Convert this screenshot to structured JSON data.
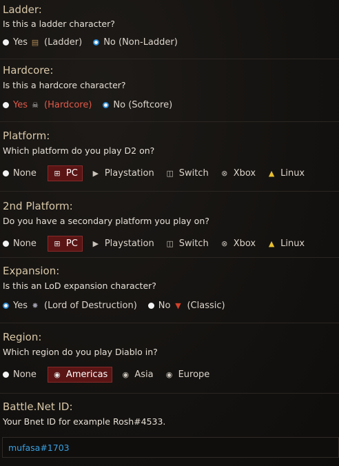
{
  "ladder": {
    "title": "Ladder:",
    "question": "Is this a ladder character?",
    "yes": "Yes",
    "yes_tag": "(Ladder)",
    "no": "No (Non-Ladder)",
    "selected": "no"
  },
  "hardcore": {
    "title": "Hardcore:",
    "question": "Is this a hardcore character?",
    "yes": "Yes",
    "yes_tag": "(Hardcore)",
    "no": "No (Softcore)",
    "selected": "no",
    "yes_color": "#e05a4a"
  },
  "platform": {
    "title": "Platform:",
    "question": "Which platform do you play D2 on?",
    "none": "None",
    "options": [
      "PC",
      "Playstation",
      "Switch",
      "Xbox",
      "Linux"
    ],
    "selected": "PC"
  },
  "platform2": {
    "title": "2nd Platform:",
    "question": "Do you have a secondary platform you play on?",
    "none": "None",
    "options": [
      "PC",
      "Playstation",
      "Switch",
      "Xbox",
      "Linux"
    ],
    "selected": "PC"
  },
  "expansion": {
    "title": "Expansion:",
    "question": "Is this an LoD expansion character?",
    "yes": "Yes",
    "yes_tag": "(Lord of Destruction)",
    "no": "No",
    "no_tag": "(Classic)",
    "selected": "yes"
  },
  "region": {
    "title": "Region:",
    "question": "Which region do you play Diablo in?",
    "none": "None",
    "options": [
      "Americas",
      "Asia",
      "Europe"
    ],
    "selected": "Americas"
  },
  "battlenet": {
    "title": "Battle.Net ID:",
    "question": "Your Bnet ID for example Rosh#4533.",
    "value": "mufasa#1703"
  },
  "colors": {
    "title": "#d9c8a8",
    "selected_bg": "#5a1414",
    "radio_checked": "#2d8cd6",
    "input_text": "#3aa0e0"
  }
}
